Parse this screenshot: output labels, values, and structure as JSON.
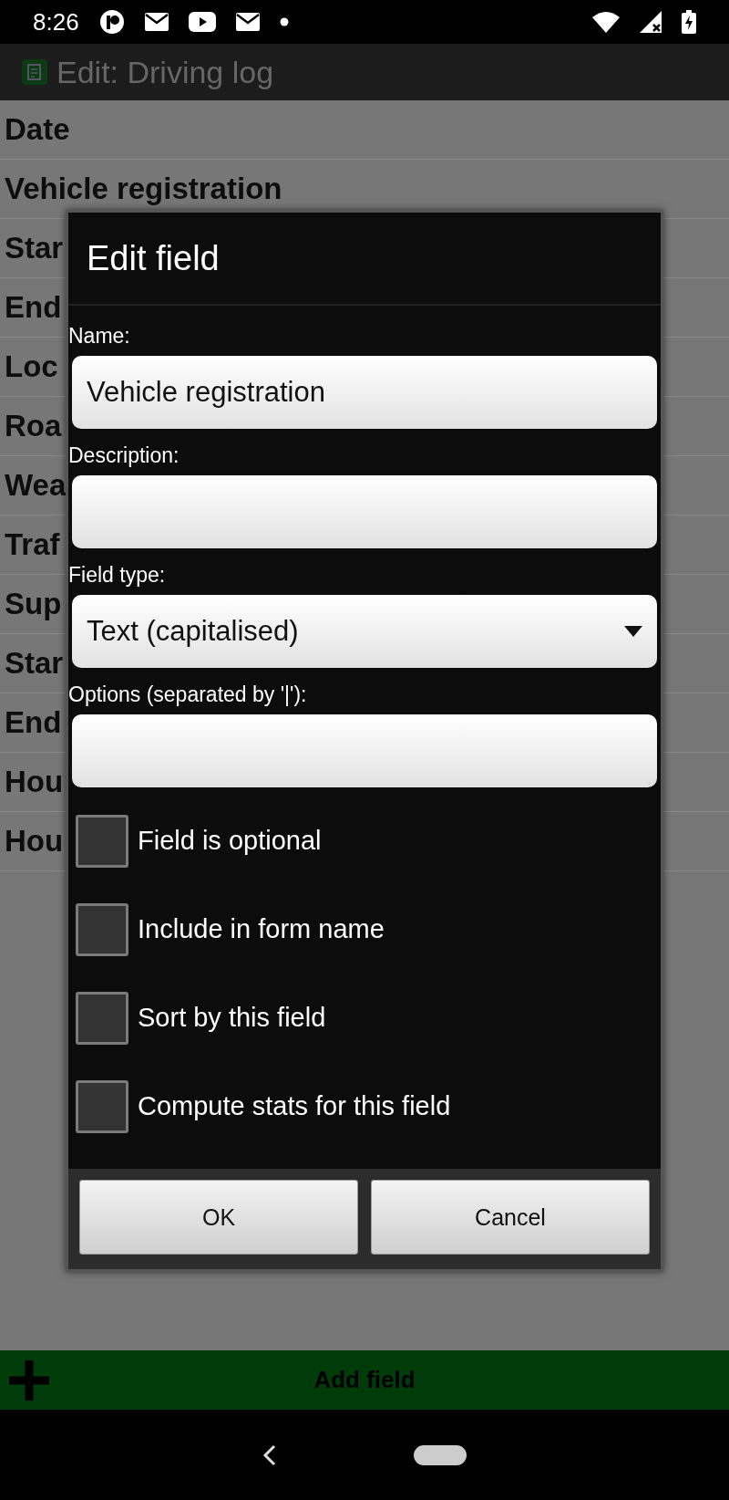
{
  "status_bar": {
    "time": "8:26"
  },
  "app_bar": {
    "title": "Edit: Driving log"
  },
  "fields_list": [
    "Date",
    "Vehicle registration",
    "Star",
    "End",
    "Loc",
    "Roa",
    "Wea",
    "Traf",
    "Sup",
    "Star",
    "End",
    "Hou",
    "Hou"
  ],
  "dialog": {
    "title": "Edit field",
    "inputs": [
      {
        "label": "Name:",
        "kind": "text",
        "value": "Vehicle registration"
      },
      {
        "label": "Description:",
        "kind": "text"
      },
      {
        "label": "Field type:",
        "kind": "dropdown",
        "value": "Text (capitalised)"
      },
      {
        "label": "Options (separated by '|'):",
        "kind": "text"
      }
    ],
    "checkboxes": [
      {
        "label": "Field is optional",
        "checked": false
      },
      {
        "label": "Include in form name",
        "checked": false
      },
      {
        "label": "Sort by this field",
        "checked": false
      },
      {
        "label": "Compute stats for this field",
        "checked": false
      }
    ],
    "buttons": [
      "OK",
      "Cancel"
    ]
  },
  "add_field_button": {
    "label": "Add field"
  }
}
